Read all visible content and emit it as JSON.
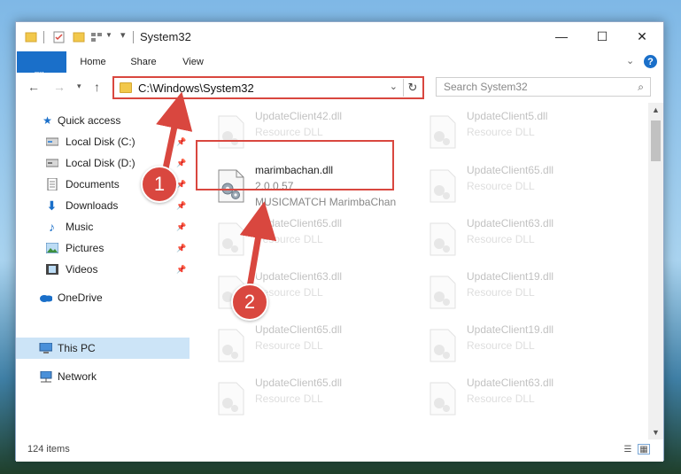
{
  "window": {
    "title": "System32",
    "controls": {
      "minimize": "—",
      "maximize": "☐",
      "close": "✕"
    }
  },
  "ribbon": {
    "tabs": [
      "File",
      "Home",
      "Share",
      "View"
    ],
    "expand_glyph": "⌄",
    "help_glyph": "?"
  },
  "address": {
    "path": "C:\\Windows\\System32",
    "search_placeholder": "Search System32"
  },
  "sidebar": {
    "items": [
      {
        "label": "Quick access",
        "icon": "star-icon",
        "pinned": false
      },
      {
        "label": "Local Disk (C:)",
        "icon": "drive-icon",
        "pinned": true
      },
      {
        "label": "Local Disk (D:)",
        "icon": "drive-icon",
        "pinned": true
      },
      {
        "label": "Documents",
        "icon": "document-icon",
        "pinned": true
      },
      {
        "label": "Downloads",
        "icon": "download-icon",
        "pinned": true
      },
      {
        "label": "Music",
        "icon": "music-icon",
        "pinned": true
      },
      {
        "label": "Pictures",
        "icon": "pictures-icon",
        "pinned": true
      },
      {
        "label": "Videos",
        "icon": "video-icon",
        "pinned": true
      },
      {
        "label": "OneDrive",
        "icon": "cloud-icon",
        "pinned": false
      },
      {
        "label": "This PC",
        "icon": "computer-icon",
        "pinned": false,
        "selected": true
      },
      {
        "label": "Network",
        "icon": "network-icon",
        "pinned": false
      }
    ]
  },
  "files": [
    {
      "name": "UpdateClient42.dll",
      "desc": "Resource DLL"
    },
    {
      "name": "UpdateClient5.dll",
      "desc": "Resource DLL"
    },
    {
      "name": "marimbachan.dll",
      "desc": "2.0.0.57",
      "sub": "MUSICMATCH MarimbaChan",
      "highlighted": true
    },
    {
      "name": "UpdateClient65.dll",
      "desc": "Resource DLL"
    },
    {
      "name": "UpdateClient65.dll",
      "desc": "Resource DLL"
    },
    {
      "name": "UpdateClient63.dll",
      "desc": "Resource DLL"
    },
    {
      "name": "UpdateClient63.dll",
      "desc": "Resource DLL"
    },
    {
      "name": "UpdateClient19.dll",
      "desc": "Resource DLL"
    },
    {
      "name": "UpdateClient65.dll",
      "desc": "Resource DLL"
    },
    {
      "name": "UpdateClient19.dll",
      "desc": "Resource DLL"
    },
    {
      "name": "UpdateClient65.dll",
      "desc": "Resource DLL"
    },
    {
      "name": "UpdateClient63.dll",
      "desc": "Resource DLL"
    }
  ],
  "status": {
    "item_count": "124 items"
  },
  "annotations": {
    "badge1": "1",
    "badge2": "2",
    "color": "#d9473f"
  },
  "colors": {
    "accent": "#1a6fc9",
    "selection": "#cce4f7"
  }
}
